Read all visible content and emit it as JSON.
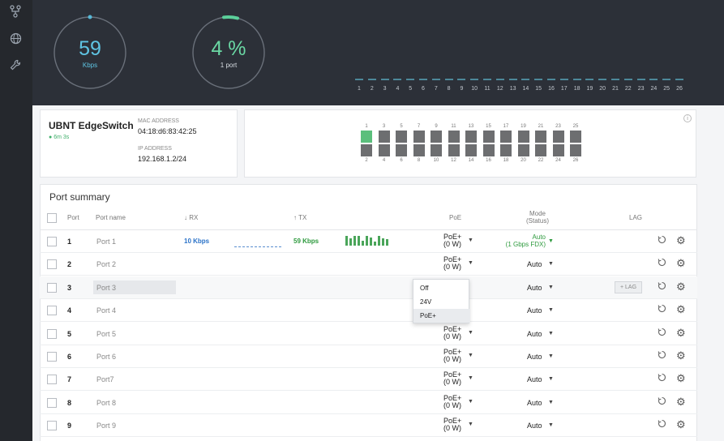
{
  "sidebar": {
    "icons": [
      "network-topology-icon",
      "globe-icon",
      "wrench-icon"
    ]
  },
  "topbar": {
    "gauge_rate": {
      "value": "59",
      "unit": "Kbps",
      "fill": 0.02
    },
    "gauge_ports": {
      "value": "4 %",
      "unit": "1 port",
      "fill": 0.04
    },
    "port_numbers": [
      "1",
      "2",
      "3",
      "4",
      "5",
      "6",
      "7",
      "8",
      "9",
      "10",
      "11",
      "12",
      "13",
      "14",
      "15",
      "16",
      "17",
      "18",
      "19",
      "20",
      "21",
      "22",
      "23",
      "24",
      "25",
      "26"
    ]
  },
  "device": {
    "name": "UBNT EdgeSwitch",
    "uptime": "6m 3s",
    "mac_label": "MAC ADDRESS",
    "mac": "04:18:d6:83:42:25",
    "ip_label": "IP ADDRESS",
    "ip": "192.168.1.2/24"
  },
  "switch_panel": {
    "top_numbers": [
      "1",
      "3",
      "5",
      "7",
      "9",
      "11",
      "13",
      "15",
      "17",
      "19",
      "21",
      "23"
    ],
    "bottom_numbers": [
      "2",
      "4",
      "6",
      "8",
      "10",
      "12",
      "14",
      "16",
      "18",
      "20",
      "22",
      "24"
    ],
    "sfp_top": "25",
    "sfp_bottom": "26",
    "active_port": "1",
    "colors": {
      "active": "#5bbf7c",
      "idle": "#6d6e70"
    }
  },
  "summary": {
    "title": "Port summary",
    "headers": {
      "port": "Port",
      "name": "Port name",
      "rx": "↓ RX",
      "tx": "↑ TX",
      "poe": "PoE",
      "mode": "Mode",
      "mode_sub": "(Status)",
      "lag": "LAG"
    },
    "rows": [
      {
        "num": "1",
        "name": "Port 1",
        "rx": "10 Kbps",
        "tx": "59 Kbps",
        "poe": "PoE+",
        "poe_w": "(0 W)",
        "mode": "Auto",
        "mode_status": "(1 Gbps FDX)"
      },
      {
        "num": "2",
        "name": "Port 2",
        "poe": "PoE+",
        "poe_w": "(0 W)",
        "mode": "Auto"
      },
      {
        "num": "3",
        "name": "Port 3",
        "mode": "Auto",
        "lag_button": "+ LAG"
      },
      {
        "num": "4",
        "name": "Port 4",
        "mode": "Auto"
      },
      {
        "num": "5",
        "name": "Port 5",
        "poe": "PoE+",
        "poe_w": "(0 W)",
        "mode": "Auto"
      },
      {
        "num": "6",
        "name": "Port 6",
        "poe": "PoE+",
        "poe_w": "(0 W)",
        "mode": "Auto"
      },
      {
        "num": "7",
        "name": "Port7",
        "poe": "PoE+",
        "poe_w": "(0 W)",
        "mode": "Auto"
      },
      {
        "num": "8",
        "name": "Port 8",
        "poe": "PoE+",
        "poe_w": "(0 W)",
        "mode": "Auto"
      },
      {
        "num": "9",
        "name": "Port 9",
        "poe": "PoE+",
        "poe_w": "(0 W)",
        "mode": "Auto"
      }
    ],
    "poe_dropdown": {
      "options": [
        "Off",
        "24V",
        "PoE+"
      ],
      "selected": "PoE+"
    }
  }
}
